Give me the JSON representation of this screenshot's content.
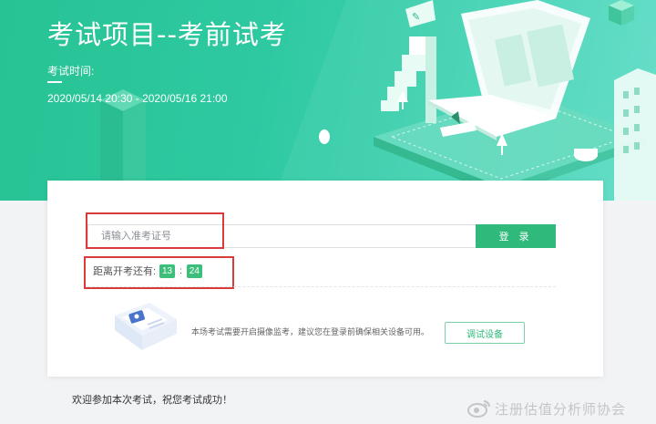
{
  "header": {
    "title": "考试项目--考前试考",
    "time_label": "考试时间:",
    "time_range": "2020/05/14 20:30 - 2020/05/16 21:00"
  },
  "login": {
    "input_placeholder": "请输入准考证号",
    "input_value": "",
    "button_label": "登 录"
  },
  "countdown": {
    "label": "距离开考还有:",
    "minutes": "13",
    "separator": ":",
    "seconds": "24"
  },
  "camera": {
    "notice": "本场考试需要开启摄像监考，建议您在登录前确保相关设备可用。",
    "test_button_label": "调试设备"
  },
  "footer": {
    "welcome": "欢迎参加本次考试，祝您考试成功！"
  },
  "watermark": {
    "text": "注册估值分析师协会"
  },
  "colors": {
    "hero_gradient_start": "#27c394",
    "hero_gradient_end": "#5fdcc7",
    "primary_green": "#2fb97a",
    "highlight_red": "#d93a3a"
  }
}
